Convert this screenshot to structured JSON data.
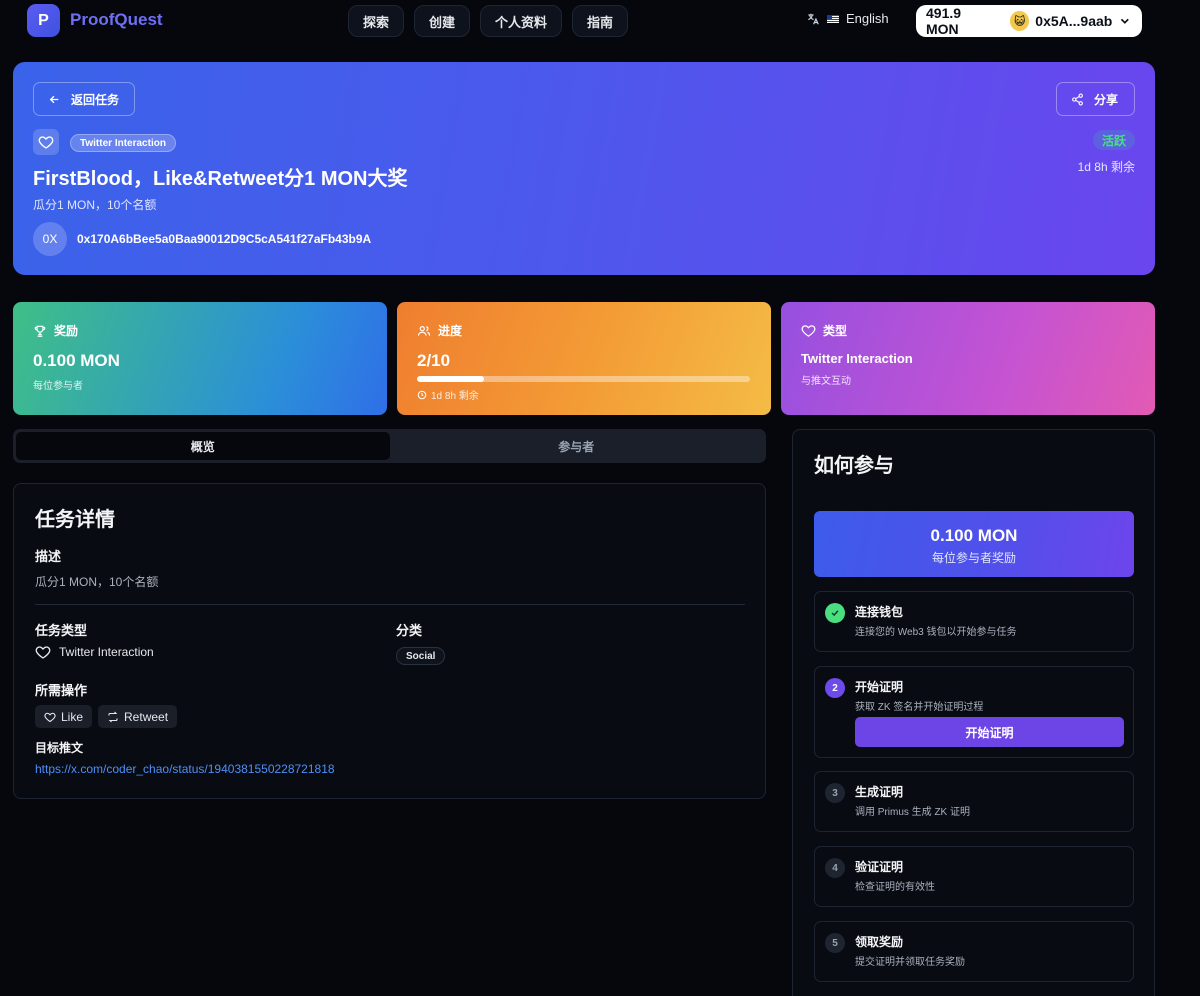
{
  "nav": {
    "logo_letter": "P",
    "brand": "ProofQuest",
    "links": [
      "探索",
      "创建",
      "个人资料",
      "指南"
    ],
    "language": "English",
    "balance": "491.9 MON",
    "wallet_address": "0x5A...9aab"
  },
  "hero": {
    "back_label": "返回任务",
    "share_label": "分享",
    "tag": "Twitter Interaction",
    "title": "FirstBlood，Like&Retweet分1 MON大奖",
    "subtitle": "瓜分1 MON，10个名额",
    "avatar_text": "0X",
    "address": "0x170A6bBee5a0Baa90012D9C5cA541f27aFb43b9A",
    "status": "活跃",
    "time_remaining": "1d 8h 剩余"
  },
  "stats": {
    "reward": {
      "label": "奖励",
      "value": "0.100 MON",
      "note": "每位参与者"
    },
    "progress": {
      "label": "进度",
      "value": "2/10",
      "fraction": 0.2,
      "time": "1d 8h 剩余"
    },
    "type": {
      "label": "类型",
      "value": "Twitter Interaction",
      "note": "与推文互动"
    }
  },
  "tabs": [
    "概览",
    "参与者"
  ],
  "details": {
    "title": "任务详情",
    "description_label": "描述",
    "description": "瓜分1 MON，10个名额",
    "task_type_label": "任务类型",
    "task_type": "Twitter Interaction",
    "category_label": "分类",
    "category": "Social",
    "actions_label": "所需操作",
    "actions": [
      "Like",
      "Retweet"
    ],
    "target_label": "目标推文",
    "target_url": "https://x.com/coder_chao/status/1940381550228721818"
  },
  "how": {
    "title": "如何参与",
    "reward_value": "0.100 MON",
    "reward_note": "每位参与者奖励",
    "steps": [
      {
        "num": "",
        "title": "连接钱包",
        "desc": "连接您的 Web3 钱包以开始参与任务"
      },
      {
        "num": "2",
        "title": "开始证明",
        "desc": "获取 ZK 签名并开始证明过程",
        "button": "开始证明"
      },
      {
        "num": "3",
        "title": "生成证明",
        "desc": "调用 Primus 生成 ZK 证明"
      },
      {
        "num": "4",
        "title": "验证证明",
        "desc": "检查证明的有效性"
      },
      {
        "num": "5",
        "title": "领取奖励",
        "desc": "提交证明并领取任务奖励"
      }
    ]
  },
  "colors": {
    "accent": "#6d45e6",
    "link": "#4f8ff7",
    "active_status": "#4ade80",
    "background": "#05070d"
  }
}
